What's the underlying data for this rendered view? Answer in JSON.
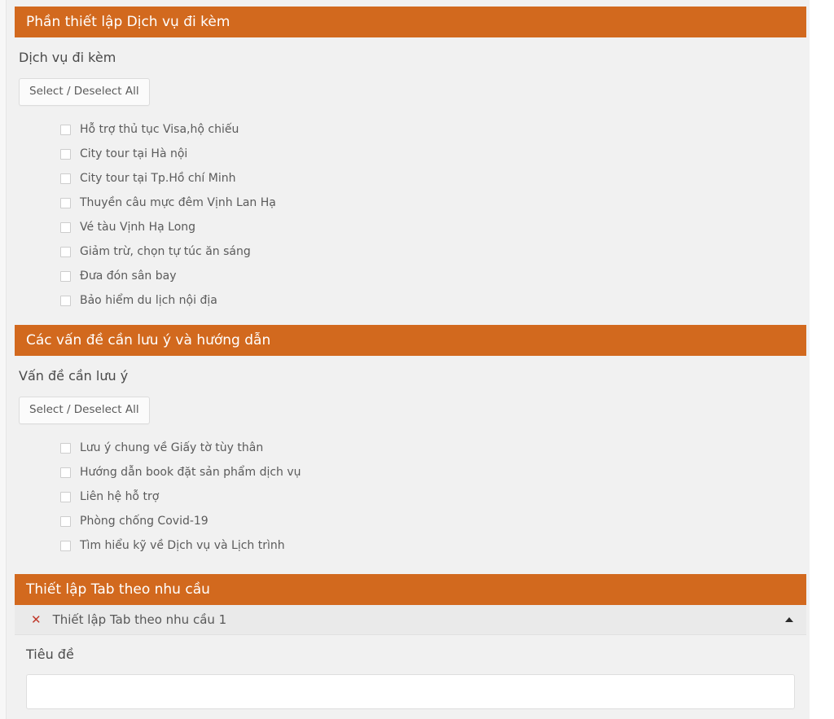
{
  "theme": {
    "accent_orange": "#d2691e",
    "page_background": "#f1f1f1",
    "remove_icon_red": "#c0392b",
    "text_color": "#5b5b5b"
  },
  "sections": [
    {
      "header": "Phần thiết lập Dịch vụ đi kèm",
      "field_label": "Dịch vụ đi kèm",
      "select_all_label": "Select / Deselect All",
      "items": [
        {
          "label": "Hỗ trợ thủ tục Visa,hộ chiếu",
          "checked": false
        },
        {
          "label": "City tour tại Hà nội",
          "checked": false
        },
        {
          "label": "City tour tại Tp.Hồ chí Minh",
          "checked": false
        },
        {
          "label": "Thuyền câu mực đêm Vịnh Lan Hạ",
          "checked": false
        },
        {
          "label": "Vé tàu Vịnh Hạ Long",
          "checked": false
        },
        {
          "label": "Giảm trừ, chọn tự túc ăn sáng",
          "checked": false
        },
        {
          "label": "Đưa đón sân bay",
          "checked": false
        },
        {
          "label": "Bảo hiểm du lịch nội địa",
          "checked": false
        }
      ]
    },
    {
      "header": "Các vấn đề cần lưu ý và hướng dẫn",
      "field_label": "Vấn đề cần lưu ý",
      "select_all_label": "Select / Deselect All",
      "items": [
        {
          "label": "Lưu ý chung về Giấy tờ tùy thân",
          "checked": false
        },
        {
          "label": "Hướng dẫn book đặt sản phẩm dịch vụ",
          "checked": false
        },
        {
          "label": "Liên hệ hỗ trợ",
          "checked": false
        },
        {
          "label": "Phòng chống Covid-19",
          "checked": false
        },
        {
          "label": "Tìm hiểu kỹ về Dịch vụ và Lịch trình",
          "checked": false
        }
      ]
    }
  ],
  "tab_section": {
    "header": "Thiết lập Tab theo nhu cầu",
    "accordion": {
      "remove_icon": "close-x-icon",
      "title": "Thiết lập Tab theo nhu cầu 1",
      "caret_icon": "chevron-up-icon",
      "expanded": true,
      "body": {
        "title_label": "Tiêu đề",
        "title_input_value": "",
        "title_input_placeholder": ""
      }
    }
  }
}
